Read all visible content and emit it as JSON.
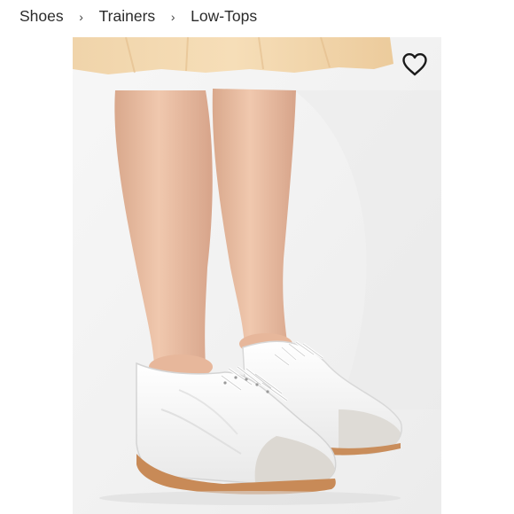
{
  "breadcrumb": {
    "items": [
      {
        "label": "Shoes"
      },
      {
        "label": "Trainers"
      },
      {
        "label": "Low-Tops"
      }
    ],
    "separator": "›"
  },
  "product_image": {
    "description_icon": "product-photo"
  },
  "wishlist": {
    "icon": "heart-outline-icon"
  }
}
